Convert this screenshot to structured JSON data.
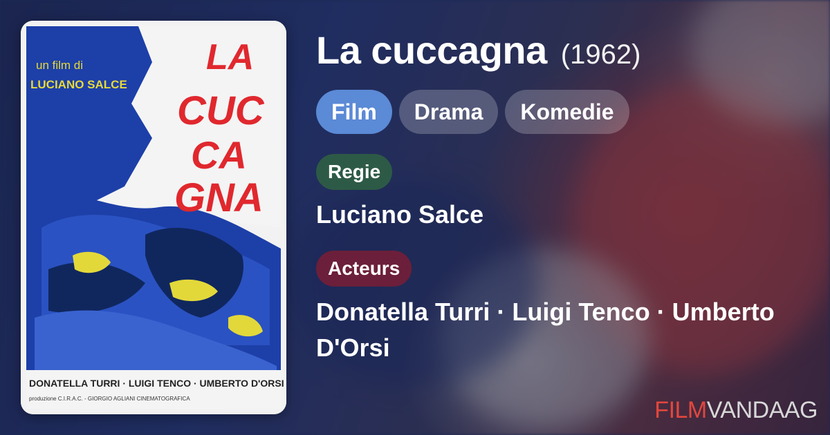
{
  "movie": {
    "title": "La cuccagna",
    "year": "(1962)"
  },
  "tags": [
    "Film",
    "Drama",
    "Komedie"
  ],
  "director_label": "Regie",
  "director": "Luciano Salce",
  "actors_label": "Acteurs",
  "actors": "Donatella Turri · Luigi Tenco · Umberto D'Orsi",
  "brand": {
    "part1": "FILM",
    "part2": "VANDAAG"
  },
  "poster": {
    "tagline": "un film di",
    "director_caps": "LUCIANO SALCE",
    "title_lines": [
      "LA",
      "CUC",
      "CA",
      "GNA"
    ],
    "cast_caps": "DONATELLA TURRI · LUIGI TENCO · UMBERTO D'ORSI",
    "credits_small": "produzione C.I.R.A.C. - GIORGIO AGLIANI   CINEMATOGRAFICA"
  },
  "colors": {
    "tag_primary": "#5b8ad6",
    "regie_label": "#2d5a46",
    "acteurs_label": "#6c1f3a",
    "brand_red": "#e2473d",
    "poster_title_red": "#e0282e",
    "poster_blue": "#1d3fa8"
  }
}
